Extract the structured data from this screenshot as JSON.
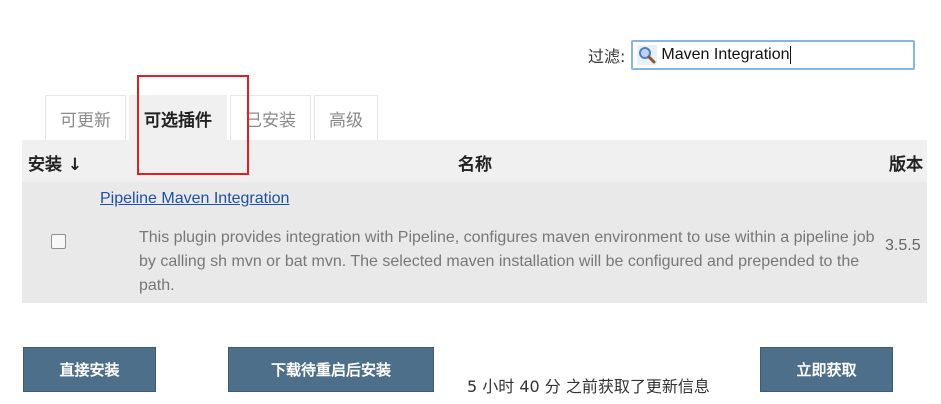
{
  "filter": {
    "label": "过滤:",
    "value": "Maven Integration",
    "icon": "search-icon"
  },
  "tabs": [
    {
      "label": "可更新",
      "active": false
    },
    {
      "label": "可选插件",
      "active": true
    },
    {
      "label": "已安装",
      "active": false
    },
    {
      "label": "高级",
      "active": false
    }
  ],
  "table": {
    "headers": {
      "install": "安装 ↓",
      "name": "名称",
      "version": "版本"
    },
    "rows": [
      {
        "name": "Pipeline Maven Integration",
        "description": "This plugin provides integration with Pipeline, configures maven environment to use within a pipeline job by calling sh mvn or bat mvn. The selected maven installation will be configured and prepended to the path.",
        "version": "3.5.5",
        "checked": false
      }
    ]
  },
  "actions": {
    "install_now": "直接安装",
    "download_restart": "下载待重启后安装",
    "update_info": "5 小时 40 分 之前获取了更新信息",
    "fetch_now": "立即获取"
  },
  "colors": {
    "highlight": "#e02020",
    "button": "#4d6f8a",
    "link": "#1f4fa8"
  }
}
